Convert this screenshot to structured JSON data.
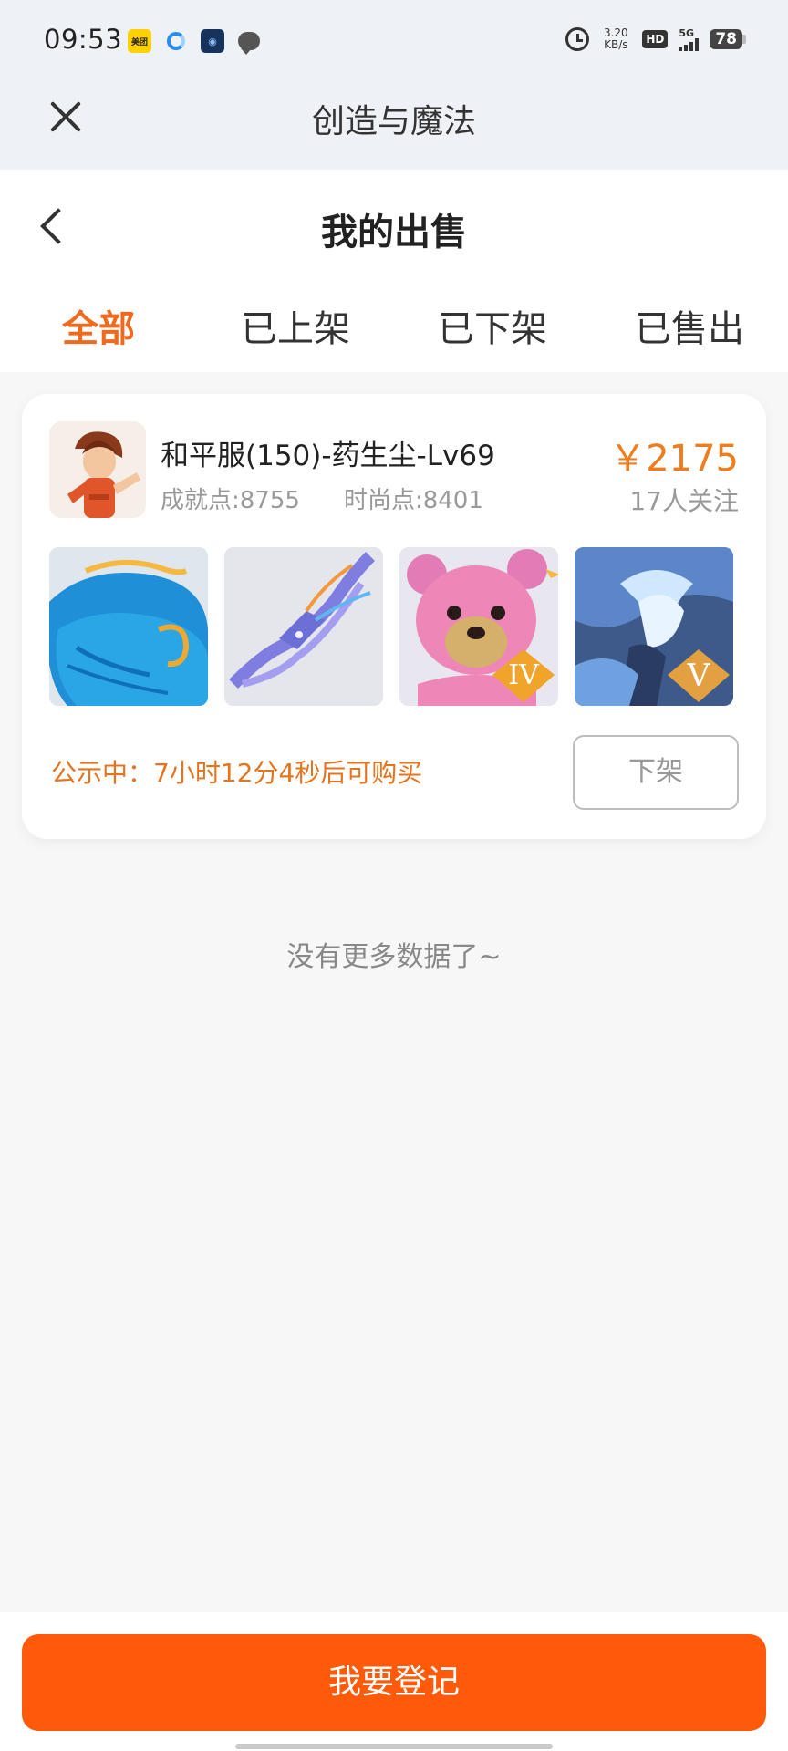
{
  "status_bar": {
    "time": "09:53",
    "net_speed_value": "3.20",
    "net_speed_unit": "KB/s",
    "hd_label": "HD",
    "signal_label": "5G",
    "battery_level": "78",
    "icons": [
      "meituan-icon",
      "browser-icon",
      "app-icon",
      "chat-icon",
      "alarm-icon"
    ]
  },
  "web_header": {
    "title": "创造与魔法"
  },
  "page": {
    "title": "我的出售",
    "tabs": [
      {
        "label": "全部",
        "active": true
      },
      {
        "label": "已上架",
        "active": false
      },
      {
        "label": "已下架",
        "active": false
      },
      {
        "label": "已售出",
        "active": false
      }
    ]
  },
  "listing": {
    "title": "和平服(150)-药生尘-Lv69",
    "achievement": "成就点:8755",
    "fashion": "时尚点:8401",
    "price": "￥2175",
    "followers": "17人关注",
    "thumbs": [
      {
        "name": "blue-whale-mount",
        "badge": ""
      },
      {
        "name": "purple-dragon-mount",
        "badge": ""
      },
      {
        "name": "pink-bear-pet",
        "badge": "IV"
      },
      {
        "name": "ice-dragon-mount",
        "badge": "V"
      }
    ],
    "notice_label": "公示中：",
    "notice_value": "7小时12分4秒后可购买",
    "delist_label": "下架"
  },
  "empty_text": "没有更多数据了~",
  "register_label": "我要登记",
  "colors": {
    "accent": "#f06a1d",
    "price": "#f07d1d",
    "button": "#ff5a0a"
  }
}
